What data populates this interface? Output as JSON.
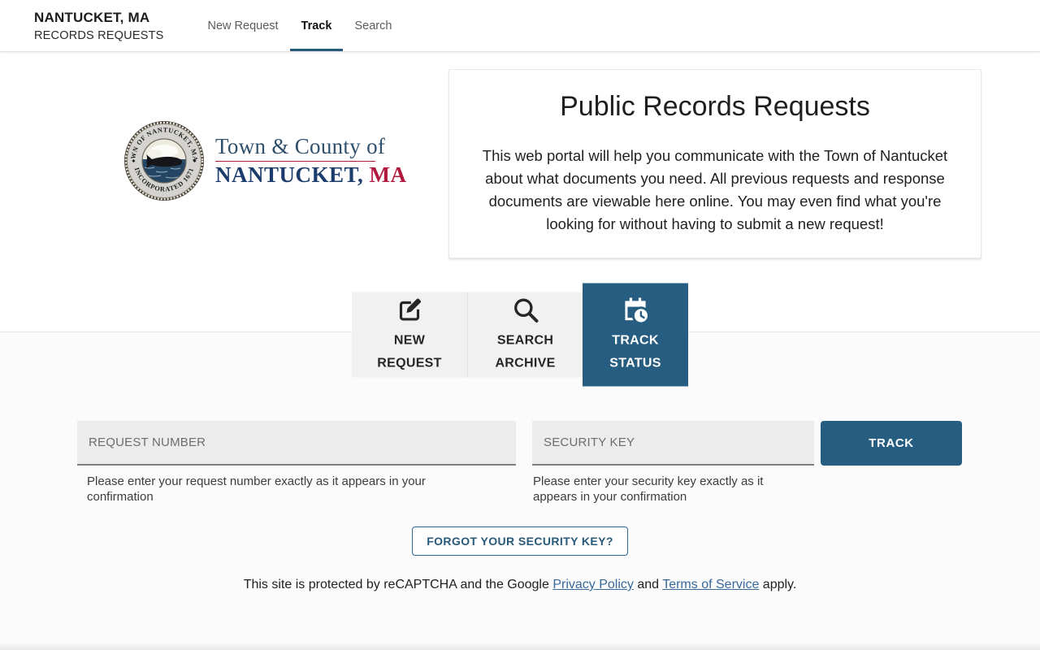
{
  "colors": {
    "accent": "#275d80",
    "link": "#38699b",
    "brand_navy": "#1d3c6e",
    "brand_crimson": "#b01a3f",
    "tile_gray": "#f1f1f1"
  },
  "header": {
    "brand_line1": "NANTUCKET, MA",
    "brand_line2": "RECORDS REQUESTS",
    "nav": [
      {
        "label": "New Request",
        "active": false
      },
      {
        "label": "Track",
        "active": true
      },
      {
        "label": "Search",
        "active": false
      }
    ]
  },
  "hero": {
    "seal": {
      "top_text": "TOWN OF NANTUCKET, MASS",
      "bottom_text": "INCORPORATED 1671"
    },
    "wordmark": {
      "line1": "Town & County of",
      "line2_town": "NANTUCKET,",
      "line2_state": "MA"
    },
    "card": {
      "title": "Public Records Requests",
      "body": "This web portal will help you communicate with the Town of Nantucket about what documents you need. All previous requests and response documents are viewable here online. You may even find what you're looking for without having to submit a new request!"
    }
  },
  "actions": [
    {
      "label": "NEW REQUEST",
      "icon": "edit-square-icon",
      "active": false
    },
    {
      "label": "SEARCH ARCHIVE",
      "icon": "search-icon",
      "active": false
    },
    {
      "label": "TRACK STATUS",
      "icon": "calendar-clock-icon",
      "active": true
    }
  ],
  "track_form": {
    "request_number": {
      "placeholder": "REQUEST NUMBER",
      "value": "",
      "helper": "Please enter your request number exactly as it appears in your confirmation"
    },
    "security_key": {
      "placeholder": "SECURITY KEY",
      "value": "",
      "helper": "Please enter your security key exactly as it appears in your confirmation"
    },
    "track_button": "TRACK",
    "forgot_button": "FORGOT YOUR SECURITY KEY?"
  },
  "footer": {
    "text_before": "This site is protected by reCAPTCHA and the Google ",
    "privacy_link": "Privacy Policy",
    "text_middle": " and ",
    "terms_link": "Terms of Service",
    "text_after": " apply."
  }
}
